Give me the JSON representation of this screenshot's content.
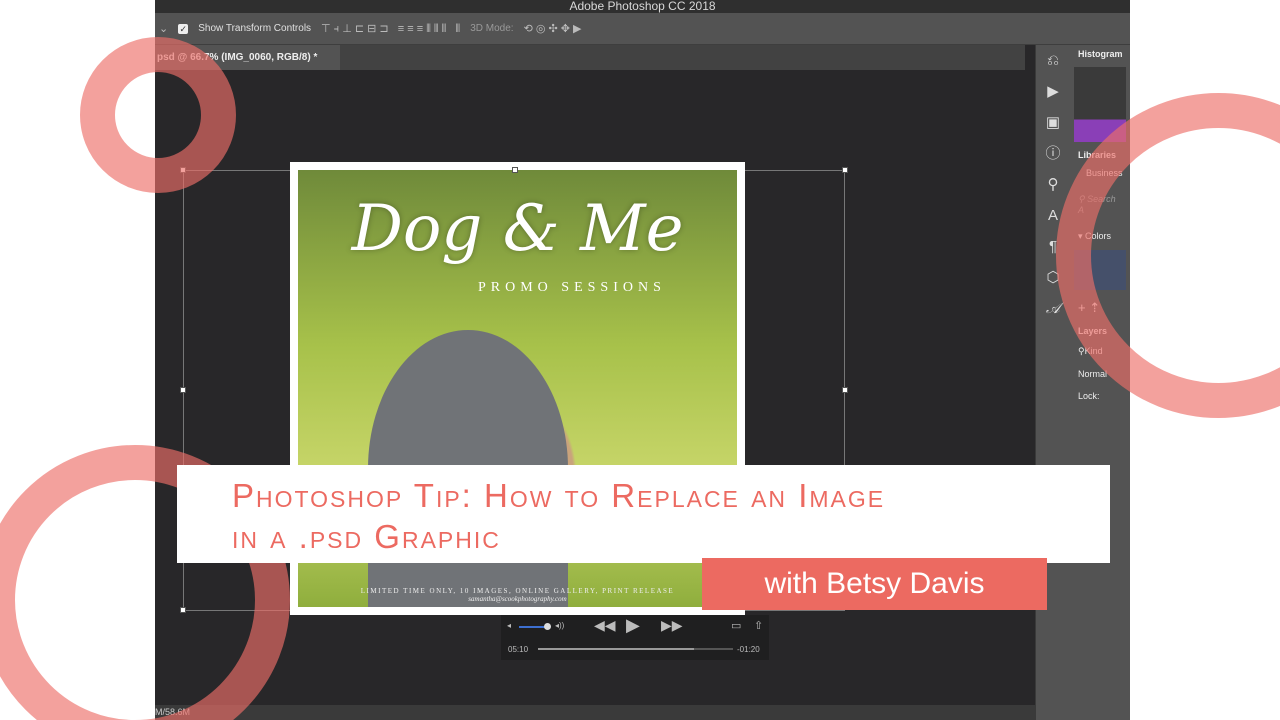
{
  "app": {
    "title": "Adobe Photoshop CC 2018",
    "doc_tab": "psd @ 66.7% (IMG_0060, RGB/8) *",
    "status": "M/58.6M"
  },
  "options": {
    "show_transform": "Show Transform Controls",
    "mode_3d": "3D Mode:"
  },
  "panels": {
    "histogram": "Histogram",
    "libraries": "Libraries",
    "library_select": "Business",
    "search_placeholder": "Search A",
    "colors": "Colors",
    "layers": "Layers",
    "kind": "Kind",
    "blend": "Normal",
    "lock": "Lock:"
  },
  "artwork": {
    "title": "Dog & Me",
    "subtitle": "PROMO SESSIONS",
    "footer1": "LIMITED TIME ONLY, 10 IMAGES, ONLINE GALLERY, PRINT RELEASE",
    "footer2": "samantha@scookphotography.com"
  },
  "player": {
    "elapsed": "05:10",
    "remaining": "-01:20",
    "progress": 0.8,
    "volume": 0.75
  },
  "banner": {
    "line1": "Photoshop Tip: How to Replace an Image",
    "line2": "in a .psd Graphic",
    "author": "with Betsy Davis"
  },
  "colors": {
    "accent": "#ec6a61"
  }
}
